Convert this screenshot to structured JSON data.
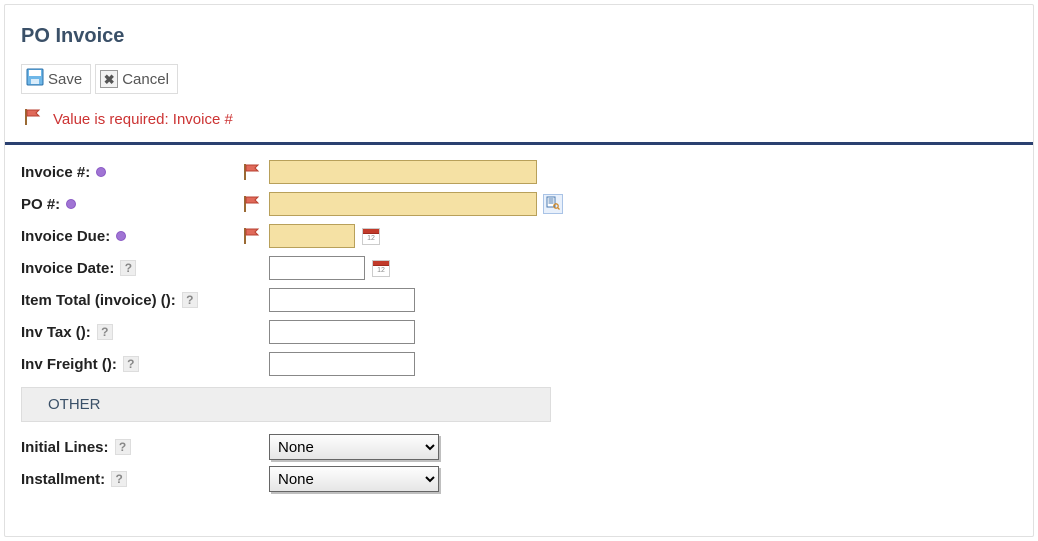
{
  "title": "PO Invoice",
  "toolbar": {
    "save_label": "Save",
    "cancel_label": "Cancel"
  },
  "error_message": "Value is required: Invoice #",
  "fields": {
    "invoice_no": {
      "label": "Invoice #:",
      "value": "",
      "required": true,
      "hint": "dot"
    },
    "po_no": {
      "label": "PO #:",
      "value": "",
      "required": true,
      "hint": "dot"
    },
    "invoice_due": {
      "label": "Invoice Due:",
      "value": "",
      "required": true,
      "hint": "dot"
    },
    "invoice_date": {
      "label": "Invoice Date:",
      "value": "",
      "hint": "?"
    },
    "item_total": {
      "label": "Item Total (invoice) ():",
      "value": "",
      "hint": "?"
    },
    "inv_tax": {
      "label": "Inv Tax ():",
      "value": "",
      "hint": "?"
    },
    "inv_freight": {
      "label": "Inv Freight ():",
      "value": "",
      "hint": "?"
    }
  },
  "section_other": "OTHER",
  "other": {
    "initial_lines": {
      "label": "Initial Lines:",
      "selected": "None",
      "options": [
        "None"
      ]
    },
    "installment": {
      "label": "Installment:",
      "selected": "None",
      "options": [
        "None"
      ]
    }
  },
  "calendar_day": "12"
}
